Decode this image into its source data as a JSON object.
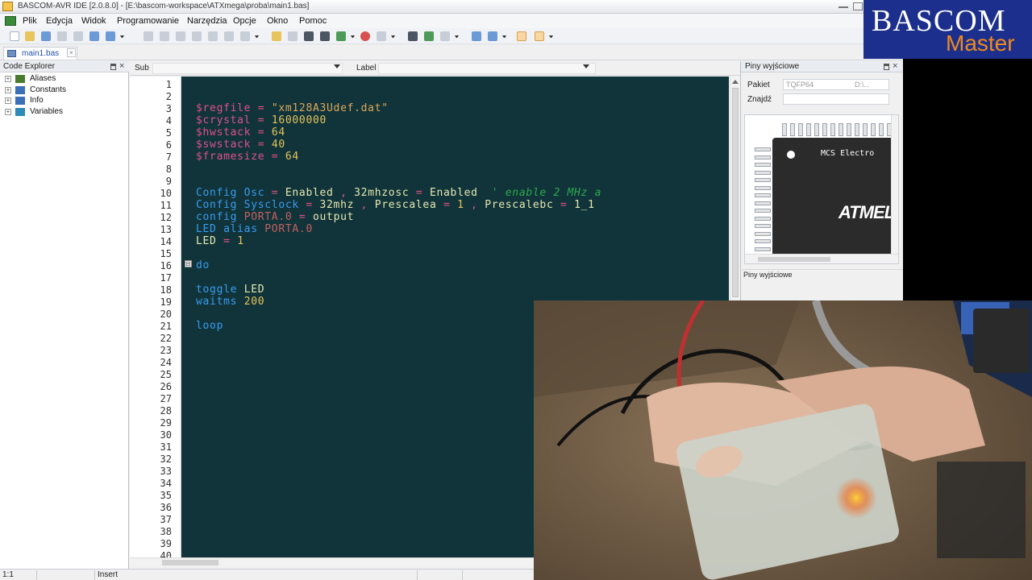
{
  "window": {
    "title": "BASCOM-AVR IDE [2.0.8.0] - [E:\\bascom-workspace\\ATXmega\\proba\\main1.bas]"
  },
  "menu": {
    "items": [
      "Plik",
      "Edycja",
      "Widok",
      "Programowanie",
      "Narzędzia",
      "Opcje",
      "Okno",
      "Pomoc"
    ]
  },
  "tabs": {
    "active": "main1.bas",
    "close_glyph": "×"
  },
  "explorer": {
    "title": "Code Explorer",
    "close_glyph": "×",
    "expand_glyph": "+",
    "items": [
      {
        "label": "Aliases",
        "icon": "alias-icon",
        "color": "#4a7a2e"
      },
      {
        "label": "Constants",
        "icon": "constant-icon",
        "color": "#3b6fb8"
      },
      {
        "label": "Info",
        "icon": "info-icon",
        "color": "#3b6fb8"
      },
      {
        "label": "Variables",
        "icon": "variable-icon",
        "color": "#2e8ab8"
      }
    ]
  },
  "editor_toolbar": {
    "sub_label": "Sub",
    "label_label": "Label"
  },
  "editor": {
    "fold_glyph": "⊟",
    "line_numbers": [
      "1",
      "2",
      "3",
      "4",
      "5",
      "6",
      "7",
      "8",
      "9",
      "10",
      "11",
      "12",
      "13",
      "14",
      "15",
      "16",
      "17",
      "18",
      "19",
      "20",
      "21",
      "22",
      "23",
      "24",
      "25",
      "26",
      "27",
      "28",
      "29",
      "30",
      "31",
      "32",
      "33",
      "34",
      "35",
      "36",
      "37",
      "38",
      "39",
      "40"
    ],
    "lines": [
      {
        "line": 3,
        "tokens": [
          [
            "$regfile",
            "c-dir"
          ],
          [
            " = ",
            "c-op"
          ],
          [
            "\"xm128A3Udef.dat\"",
            "c-str"
          ]
        ]
      },
      {
        "line": 4,
        "tokens": [
          [
            "$crystal",
            "c-dir"
          ],
          [
            " = ",
            "c-op"
          ],
          [
            "16000000",
            "c-num"
          ]
        ]
      },
      {
        "line": 5,
        "tokens": [
          [
            "$hwstack",
            "c-dir"
          ],
          [
            " = ",
            "c-op"
          ],
          [
            "64",
            "c-num"
          ]
        ]
      },
      {
        "line": 6,
        "tokens": [
          [
            "$swstack",
            "c-dir"
          ],
          [
            " = ",
            "c-op"
          ],
          [
            "40",
            "c-num"
          ]
        ]
      },
      {
        "line": 7,
        "tokens": [
          [
            "$framesize",
            "c-dir"
          ],
          [
            " = ",
            "c-op"
          ],
          [
            "64",
            "c-num"
          ]
        ]
      },
      {
        "line": 10,
        "tokens": [
          [
            "Config Osc",
            "c-kw"
          ],
          [
            " = ",
            "c-op"
          ],
          [
            "Enabled",
            "c-id"
          ],
          [
            " , ",
            "c-op"
          ],
          [
            "32mhzosc",
            "c-id"
          ],
          [
            " = ",
            "c-op"
          ],
          [
            "Enabled",
            "c-id"
          ],
          [
            "  ' enable 2 MHz a",
            "c-cmt"
          ]
        ]
      },
      {
        "line": 11,
        "tokens": [
          [
            "Config Sysclock",
            "c-kw"
          ],
          [
            " = ",
            "c-op"
          ],
          [
            "32mhz",
            "c-id"
          ],
          [
            " , ",
            "c-op"
          ],
          [
            "Prescalea",
            "c-id"
          ],
          [
            " = ",
            "c-op"
          ],
          [
            "1",
            "c-num"
          ],
          [
            " , ",
            "c-op"
          ],
          [
            "Prescalebc",
            "c-id"
          ],
          [
            " = ",
            "c-op"
          ],
          [
            "1_1",
            "c-id"
          ]
        ]
      },
      {
        "line": 12,
        "tokens": [
          [
            "config",
            "c-kw"
          ],
          [
            " ",
            "c-op"
          ],
          [
            "PORTA.0",
            "c-port"
          ],
          [
            " = ",
            "c-op"
          ],
          [
            "output",
            "c-id"
          ]
        ]
      },
      {
        "line": 13,
        "tokens": [
          [
            "LED alias",
            "c-kw"
          ],
          [
            " ",
            "c-op"
          ],
          [
            "PORTA.0",
            "c-port"
          ]
        ]
      },
      {
        "line": 14,
        "tokens": [
          [
            "LED",
            "c-id"
          ],
          [
            " = ",
            "c-op"
          ],
          [
            "1",
            "c-num"
          ]
        ]
      },
      {
        "line": 16,
        "tokens": [
          [
            "do",
            "c-kw"
          ]
        ]
      },
      {
        "line": 18,
        "tokens": [
          [
            "toggle",
            "c-kw"
          ],
          [
            " ",
            "c-op"
          ],
          [
            "LED",
            "c-id"
          ]
        ]
      },
      {
        "line": 19,
        "tokens": [
          [
            "waitms",
            "c-kw"
          ],
          [
            " ",
            "c-op"
          ],
          [
            "200",
            "c-num"
          ]
        ]
      },
      {
        "line": 21,
        "tokens": [
          [
            "loop",
            "c-kw"
          ]
        ]
      }
    ]
  },
  "pins_panel": {
    "title": "Piny wyjściowe",
    "close_glyph": "×",
    "package_label": "Pakiet",
    "package_value": "TQFP64",
    "package_path": "D:\\...",
    "find_label": "Znajdź",
    "find_value": "",
    "chip_text": "MCS Electro",
    "chip_logo": "ATMEL",
    "footer": "Piny wyjściowe"
  },
  "statusbar": {
    "position": "1:1",
    "mode": "Insert"
  },
  "brand": {
    "line1": "BASCOM",
    "line2": "Master"
  }
}
